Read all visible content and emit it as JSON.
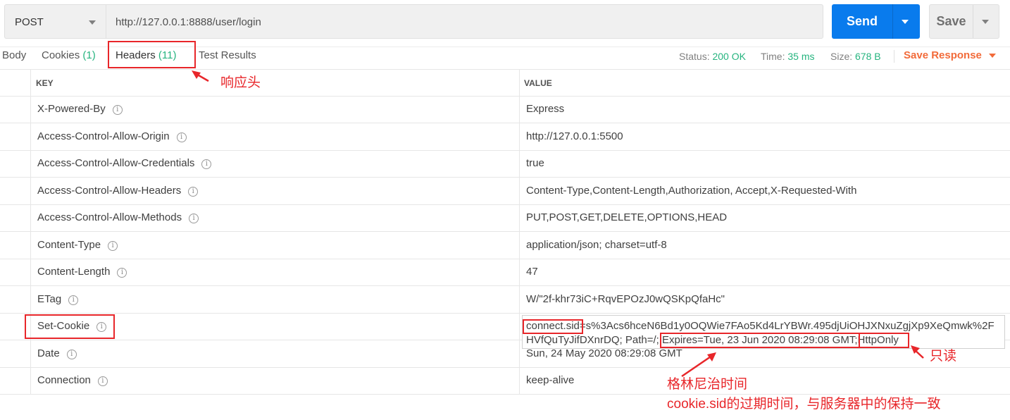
{
  "request": {
    "method": "POST",
    "url": "http://127.0.0.1:8888/user/login",
    "send_label": "Send",
    "save_label": "Save"
  },
  "response_tabs": [
    {
      "label": "Body",
      "count": ""
    },
    {
      "label": "Cookies",
      "count": "(1)"
    },
    {
      "label": "Headers",
      "count": "(11)"
    },
    {
      "label": "Test Results",
      "count": ""
    }
  ],
  "status": {
    "status_label": "Status:",
    "status_value": "200 OK",
    "time_label": "Time:",
    "time_value": "35 ms",
    "size_label": "Size:",
    "size_value": "678 B",
    "save_response": "Save Response"
  },
  "table": {
    "key_header": "KEY",
    "value_header": "VALUE",
    "rows": [
      {
        "key": "X-Powered-By",
        "value": "Express"
      },
      {
        "key": "Access-Control-Allow-Origin",
        "value": "http://127.0.0.1:5500"
      },
      {
        "key": "Access-Control-Allow-Credentials",
        "value": "true"
      },
      {
        "key": "Access-Control-Allow-Headers",
        "value": "Content-Type,Content-Length,Authorization, Accept,X-Requested-With"
      },
      {
        "key": "Access-Control-Allow-Methods",
        "value": "PUT,POST,GET,DELETE,OPTIONS,HEAD"
      },
      {
        "key": "Content-Type",
        "value": "application/json; charset=utf-8"
      },
      {
        "key": "Content-Length",
        "value": "47"
      },
      {
        "key": "ETag",
        "value": "W/\"2f-khr73iC+RqvEPOzJ0wQSKpQfaHc\""
      },
      {
        "key": "Set-Cookie",
        "value": ""
      },
      {
        "key": "Date",
        "value": "Sun, 24 May 2020 08:29:08 GMT"
      },
      {
        "key": "Connection",
        "value": "keep-alive"
      }
    ],
    "set_cookie": {
      "name": "connect.sid",
      "line1_rest": "=s%3Acs6hceN6Bd1y0OQWie7FAo5Kd4LrYBWr.495djUiOHJXNxuZgjXp9XeQmwk%2F",
      "line2_start": "HVfQuTyJifDXnrDQ; Path=/; ",
      "expires": "Expires=Tue, 23 Jun 2020 08:29:08 GMT;",
      "httponly": "HttpOnly"
    }
  },
  "annotations": {
    "headers_note": "响应头",
    "readonly_note": "只读",
    "gmt_note": "格林尼治时间",
    "expiry_note": "cookie.sid的过期时间，与服务器中的保持一致"
  },
  "colors": {
    "send": "#097bed",
    "success": "#26b47f",
    "save_response": "#f26b3a",
    "annotation": "#e8262a"
  },
  "info_icon_glyph": "i"
}
